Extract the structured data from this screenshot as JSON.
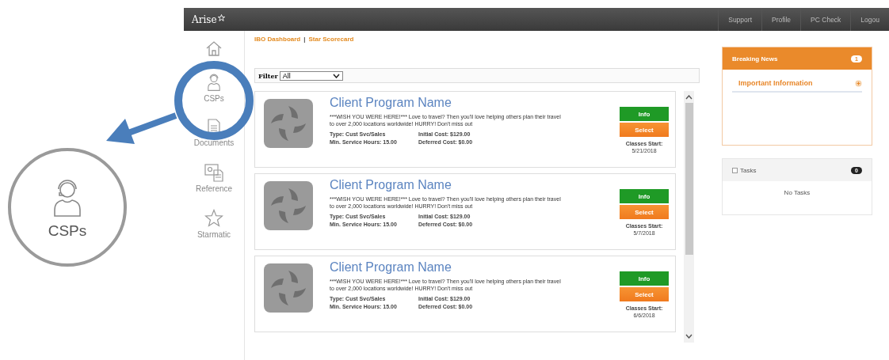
{
  "callout": {
    "label": "CSPs"
  },
  "top_bar": {
    "logo": "Arise",
    "links": [
      "Support",
      "Profile",
      "PC Check",
      "Logou"
    ]
  },
  "sidebar": {
    "items": [
      {
        "kind": "home"
      },
      {
        "kind": "csps",
        "label": "CSPs"
      },
      {
        "kind": "documents",
        "label": "Documents"
      },
      {
        "kind": "reference",
        "label": "Reference"
      },
      {
        "kind": "starmatic",
        "label": "Starmatic"
      }
    ]
  },
  "breadcrumbs": [
    "IBO Dashboard",
    "|",
    "Star Scorecard"
  ],
  "filter": {
    "label": "Filter",
    "value": "All"
  },
  "programs": [
    {
      "title": "Client Program Name",
      "description": "***WISH YOU WERE HERE!*** Love to travel? Then you'll love helping others plan their travel to over 2,000 locations worldwide! HURRY! Don't miss out",
      "type": "Type: Cust Svc/Sales",
      "hours": "Min. Service Hours: 15.00",
      "initial_cost": "Initial Cost: $129.00",
      "deferred_cost": "Deferred Cost: $0.00",
      "info": "Info",
      "select": "Select",
      "classes_label": "Classes Start:",
      "date": "5/21/2018"
    },
    {
      "title": "Client Program Name",
      "description": "***WISH YOU WERE HERE!*** Love to travel? Then you'll love helping others plan their travel to over 2,000 locations worldwide! HURRY! Don't miss out",
      "type": "Type: Cust Svc/Sales",
      "hours": "Min. Service Hours: 15.00",
      "initial_cost": "Initial Cost: $129.00",
      "deferred_cost": "Deferred Cost: $0.00",
      "info": "Info",
      "select": "Select",
      "classes_label": "Classes Start:",
      "date": "5/7/2018"
    },
    {
      "title": "Client Program Name",
      "description": "***WISH YOU WERE HERE!*** Love to travel? Then you'll love helping others plan their travel to over 2,000 locations worldwide! HURRY! Don't miss out",
      "type": "Type: Cust Svc/Sales",
      "hours": "Min. Service Hours: 15.00",
      "initial_cost": "Initial Cost: $129.00",
      "deferred_cost": "Deferred Cost: $0.00",
      "info": "Info",
      "select": "Select",
      "classes_label": "Classes Start:",
      "date": "6/6/2018"
    }
  ],
  "breaking_news": {
    "title": "Breaking News",
    "count": "1",
    "item": "Important Information"
  },
  "tasks": {
    "title": "Tasks",
    "count": "0",
    "empty": "No Tasks"
  }
}
